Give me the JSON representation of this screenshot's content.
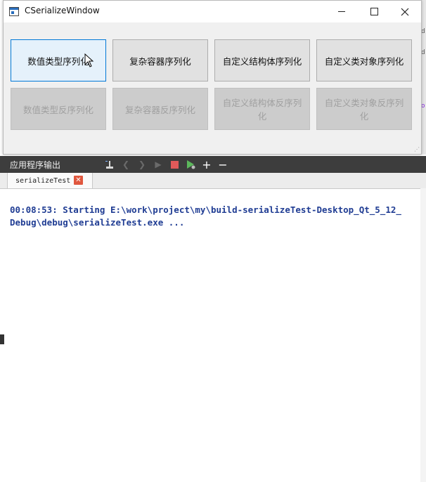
{
  "window": {
    "title": "CSerializeWindow",
    "buttons_row1": [
      "数值类型序列化",
      "复杂容器序列化",
      "自定义结构体序列化",
      "自定义类对象序列化"
    ],
    "buttons_row2": [
      "数值类型反序列化",
      "复杂容器反序列化",
      "自定义结构体反序列化",
      "自定义类对象反序列化"
    ]
  },
  "output_pane": {
    "title": "应用程序输出",
    "tab_label": "serializeTest",
    "lines": [
      "00:08:53: Starting E:\\work\\project\\my\\build-serializeTest-Desktop_Qt_5_12_",
      "Debug\\debug\\serializeTest.exe ..."
    ],
    "text_color": "#1f3c93"
  },
  "background": {
    "glyphs": [
      "d",
      "d",
      "o"
    ]
  },
  "icons": [
    "app-icon",
    "minimize-icon",
    "maximize-icon",
    "close-icon",
    "broom-icon",
    "arrow-left-icon",
    "arrow-right-icon",
    "run-icon",
    "stop-icon",
    "debug-run-icon",
    "plus-icon",
    "minus-icon",
    "tab-close-icon",
    "mouse-cursor-icon"
  ]
}
